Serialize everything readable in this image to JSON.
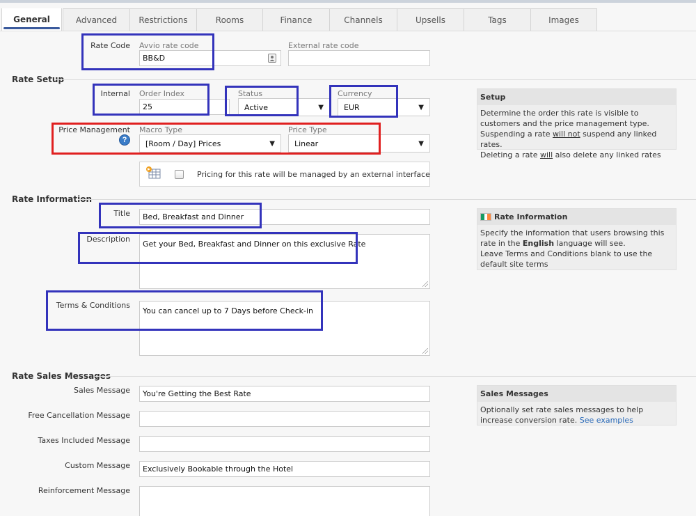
{
  "tabs": [
    "General",
    "Advanced",
    "Restrictions",
    "Rooms",
    "Finance",
    "Channels",
    "Upsells",
    "Tags",
    "Images"
  ],
  "rate_code": {
    "label": "Rate Code",
    "avvio_label": "Avvio rate code",
    "avvio_value": "BB&D",
    "external_label": "External rate code",
    "external_value": ""
  },
  "rate_setup": {
    "section": "Rate Setup",
    "internal_label": "Internal",
    "order_index_label": "Order Index",
    "order_index_value": "25",
    "status_label": "Status",
    "status_value": "Active",
    "currency_label": "Currency",
    "currency_value": "EUR",
    "price_mgmt_label": "Price Management",
    "macro_type_label": "Macro Type",
    "macro_type_value": "[Room / Day] Prices",
    "price_type_label": "Price Type",
    "price_type_value": "Linear",
    "external_interface_text": "Pricing for this rate will be managed by an external interface",
    "help_glyph": "?"
  },
  "setup_panel": {
    "title": "Setup",
    "line1": "Determine the order this rate is visible to customers and the price management type.",
    "line2_pre": "Suspending a rate ",
    "line2_u": "will not",
    "line2_post": " suspend any linked rates.",
    "line3_pre": "Deleting a rate ",
    "line3_u": "will",
    "line3_post": " also delete any linked rates"
  },
  "rate_info": {
    "section": "Rate Information",
    "title_label": "Title",
    "title_value": "Bed, Breakfast and Dinner",
    "description_label": "Description",
    "description_value": "Get your Bed, Breakfast and Dinner on this exclusive Rate",
    "terms_label": "Terms & Conditions",
    "terms_value": "You can cancel up to 7 Days before Check-in"
  },
  "rate_info_panel": {
    "title": "Rate Information",
    "flag_colors": [
      "#169b62",
      "#ffffff",
      "#ff883e"
    ],
    "line1_pre": "Specify the information that users browsing this rate in the ",
    "line1_bold": "English",
    "line1_post": " language will see.",
    "line2": "Leave Terms and Conditions blank to use the default site terms"
  },
  "sales_messages": {
    "section": "Rate Sales Messages",
    "sales_label": "Sales Message",
    "sales_value": "You're Getting the Best Rate",
    "free_cancel_label": "Free Cancellation Message",
    "free_cancel_value": "",
    "taxes_label": "Taxes Included Message",
    "taxes_value": "",
    "custom_label": "Custom Message",
    "custom_value": "Exclusively Bookable through the Hotel",
    "reinforcement_label": "Reinforcement Message",
    "reinforcement_value": ""
  },
  "sales_panel": {
    "title": "Sales Messages",
    "text": "Optionally set rate sales messages to help increase conversion rate.",
    "link": "See examples"
  },
  "colors": {
    "highlight_blue": "#3333bb",
    "highlight_red": "#e02020",
    "active_tab_underline": "#3a5a9c",
    "link": "#2a6ab8"
  }
}
